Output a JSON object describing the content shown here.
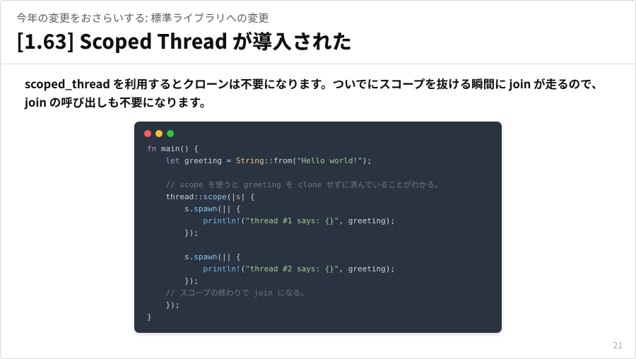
{
  "breadcrumb": "今年の変更をおさらいする: 標準ライブラリへの変更",
  "title": "[1.63] Scoped Thread が導入された",
  "description": "scoped_thread を利用するとクローンは不要になります。ついでにスコープを抜ける瞬間に join が走るので、join の呼び出しも不要になります。",
  "page_number": "21",
  "code": {
    "t01a": "fn",
    "t01b": " main() {",
    "t02a": "    ",
    "t02b": "let",
    "t02c": " greeting = ",
    "t02d": "String",
    "t02e": "::from(",
    "t02f": "\"Hello world!\"",
    "t02g": ");",
    "t03": "",
    "t04a": "    ",
    "t04b": "// scope を使うと greeting を clone せずに済んでいることがわかる。",
    "t05a": "    thread::",
    "t05b": "scope",
    "t05c": "(|",
    "t05d": "s",
    "t05e": "| {",
    "t06a": "        s.",
    "t06b": "spawn",
    "t06c": "(|| {",
    "t07a": "            ",
    "t07b": "println!",
    "t07c": "(",
    "t07d": "\"thread #1 says: {}\"",
    "t07e": ", greeting);",
    "t08": "        });",
    "t09": "",
    "t10a": "        s.",
    "t10b": "spawn",
    "t10c": "(|| {",
    "t11a": "            ",
    "t11b": "println!",
    "t11c": "(",
    "t11d": "\"thread #2 says: {}\"",
    "t11e": ", greeting);",
    "t12": "        });",
    "t13a": "    ",
    "t13b": "// スコープの終わりで join になる。",
    "t14": "    });",
    "t15": "}"
  }
}
